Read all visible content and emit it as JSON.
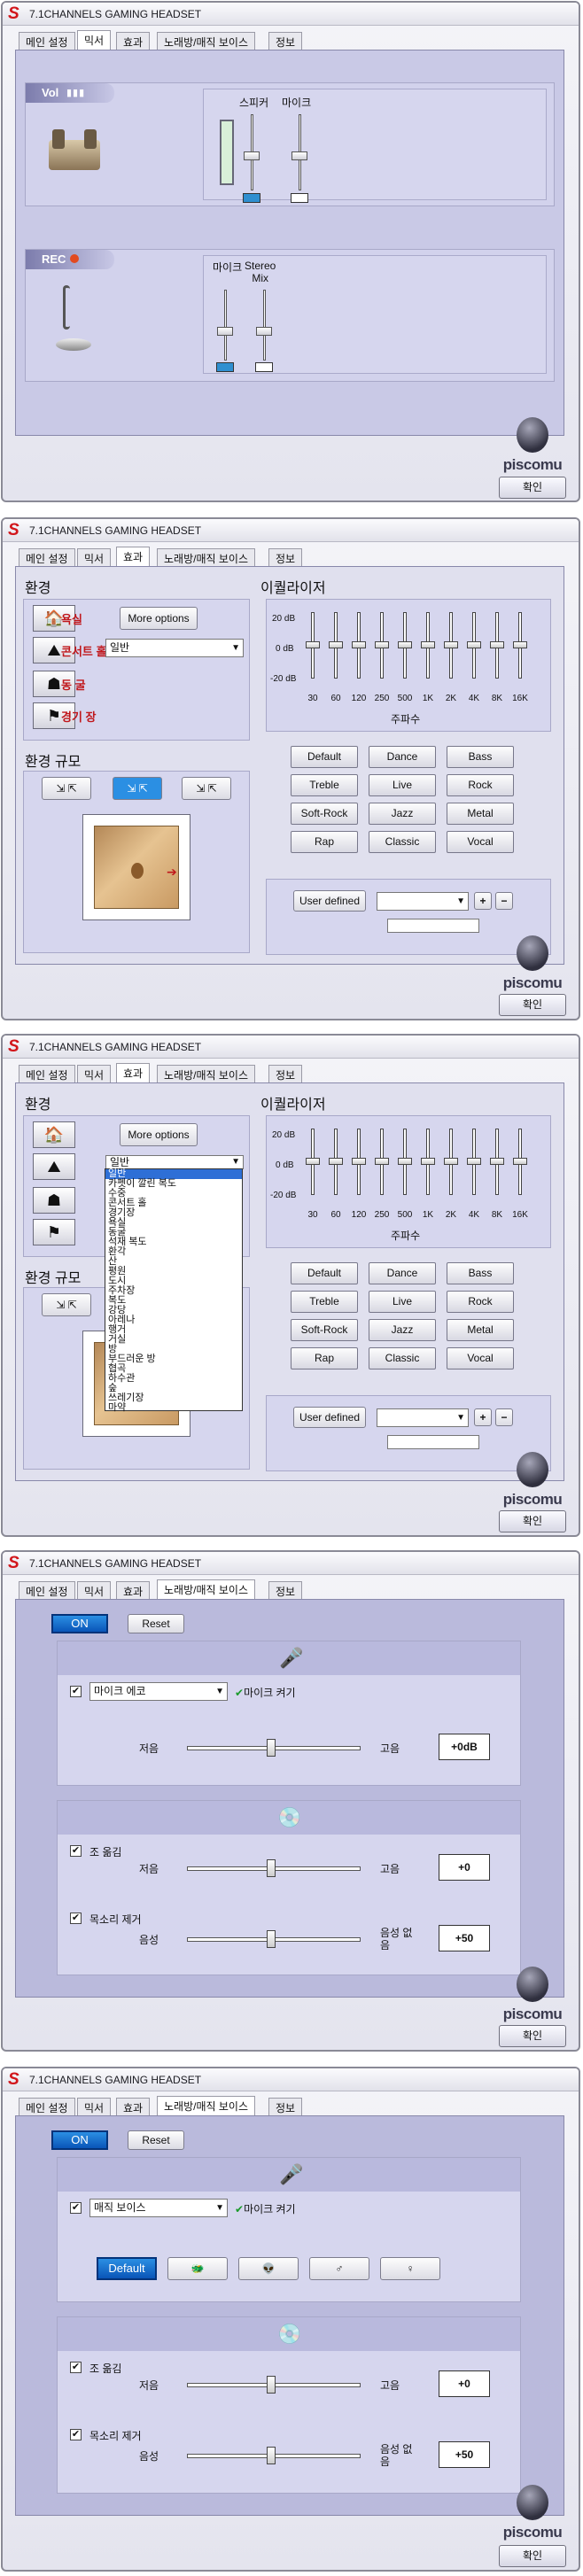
{
  "app": {
    "title": "7.1CHANNELS GAMING HEADSET",
    "brand": "piscomu",
    "ok": "확인"
  },
  "tabs": [
    "메인 설정",
    "믹서",
    "효과",
    "노래방/매직 보이스",
    "정보"
  ],
  "mixer": {
    "vol_label": "Vol",
    "rec_label": "REC",
    "playback_channels": [
      "스피커",
      "마이크"
    ],
    "record_channels": [
      "마이크",
      "Stereo\nMix"
    ]
  },
  "effects": {
    "env_title": "환경",
    "env_size_title": "환경 규모",
    "more_options": "More options",
    "env_select": "일반",
    "env_labels": [
      "욕실",
      "콘서트 홀",
      "동 굴",
      "경기 장"
    ],
    "eq_title": "이퀄라이저",
    "eq_db": [
      "20 dB",
      "0 dB",
      "-20 dB"
    ],
    "eq_freqs": [
      "30",
      "60",
      "120",
      "250",
      "500",
      "1K",
      "2K",
      "4K",
      "8K",
      "16K"
    ],
    "eq_xlabel": "주파수",
    "presets": [
      "Default",
      "Dance",
      "Bass",
      "Treble",
      "Live",
      "Rock",
      "Soft-Rock",
      "Jazz",
      "Metal",
      "Rap",
      "Classic",
      "Vocal"
    ],
    "user_defined": "User defined",
    "plus": "+",
    "minus": "−"
  },
  "env_dropdown": {
    "items": [
      "일반",
      "카펫이 깔린 복도",
      "수중",
      "콘서트 홀",
      "경기장",
      "욕실",
      "동굴",
      "석재 복도",
      "환각",
      "산",
      "평원",
      "도시",
      "주차장",
      "복도",
      "강당",
      "아레나",
      "행거",
      "거실",
      "방",
      "부드러운 방",
      "협곡",
      "하수관",
      "숲",
      "쓰레기장",
      "마약"
    ],
    "note": "일반 ↔ 2열 배열"
  },
  "karaoke": {
    "on": "ON",
    "reset": "Reset",
    "mic_echo_select": "마이크 에코",
    "magic_voice_select": "매직 보이스",
    "mic_on": "마이크 켜기",
    "low": "저음",
    "high": "고음",
    "echo_value": "+0dB",
    "key_adjust": "조 옮김",
    "key_value": "+0",
    "vocal_cancel": "목소리 제거",
    "vocal": "음성",
    "no_vocal": "음성 없음",
    "vocal_value": "+50",
    "voice_default": "Default",
    "voice_icons": [
      "monster-icon",
      "alien-icon",
      "male-icon",
      "female-icon"
    ]
  },
  "colors": {
    "panel": "#babadc",
    "section": "#d6d6ee",
    "accent": "#0a55b8",
    "red": "#d2161b"
  }
}
